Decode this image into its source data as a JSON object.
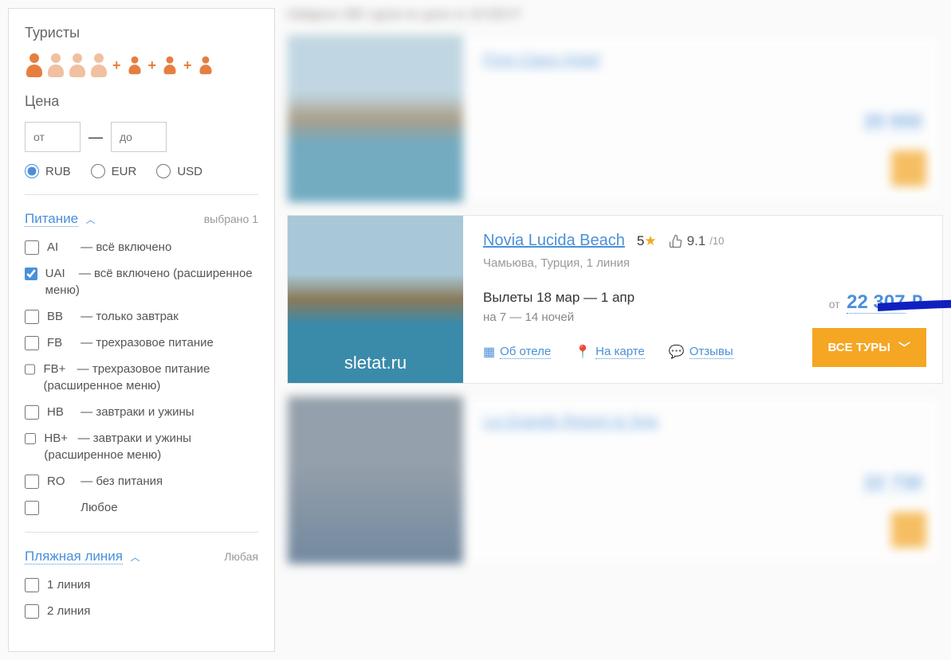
{
  "sidebar": {
    "tourists_label": "Туристы",
    "price_label": "Цена",
    "price_from_placeholder": "от",
    "price_to_placeholder": "до",
    "currency": {
      "rub": "RUB",
      "eur": "EUR",
      "usd": "USD"
    },
    "meals": {
      "title": "Питание",
      "hint": "выбрано 1",
      "items": [
        {
          "abbr": "AI",
          "label": "— всё включено",
          "checked": false
        },
        {
          "abbr": "UAI",
          "label": "— всё включено (расширенное меню)",
          "checked": true
        },
        {
          "abbr": "BB",
          "label": "— только завтрак",
          "checked": false
        },
        {
          "abbr": "FB",
          "label": "— трехразовое питание",
          "checked": false
        },
        {
          "abbr": "FB+",
          "label": "— трехразовое питание (расширенное меню)",
          "checked": false
        },
        {
          "abbr": "HB",
          "label": "— завтраки и ужины",
          "checked": false
        },
        {
          "abbr": "HB+",
          "label": "— завтраки и ужины (расширенное меню)",
          "checked": false
        },
        {
          "abbr": "RO",
          "label": "— без питания",
          "checked": false
        },
        {
          "abbr": "",
          "label": "Любое",
          "checked": false
        }
      ]
    },
    "beachline": {
      "title": "Пляжная линия",
      "hint": "Любая",
      "items": [
        {
          "label": "1 линия"
        },
        {
          "label": "2 линия"
        }
      ]
    }
  },
  "main": {
    "results_header": "Найдено 385 туров по цене от 20 650 Р",
    "hotel_focused": {
      "name": "Novia Lucida Beach",
      "stars": "5",
      "rating": "9.1",
      "rating_max": "/10",
      "location": "Чамьюва, Турция, 1 линия",
      "dates": "Вылеты 18 мар — 1 апр",
      "nights": "на 7  —  14 ночей",
      "price_from": "от",
      "price": "22 307",
      "currency": "₽",
      "watermark": "sletat.ru",
      "links": {
        "about": "Об отеле",
        "map": "На карте",
        "reviews": "Отзывы"
      },
      "all_tours": "ВСЕ ТУРЫ"
    },
    "hotel_blurred_1": {
      "name": "First Class Hotel",
      "price": "20 650"
    },
    "hotel_blurred_2": {
      "name": "La Grande Resort & Spa",
      "price": "22 730"
    }
  }
}
